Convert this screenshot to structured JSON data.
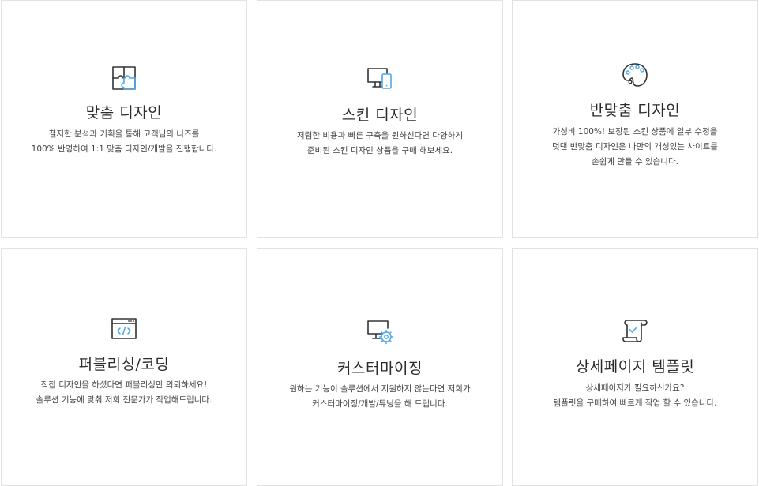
{
  "cards": [
    {
      "title": "맞춤 디자인",
      "lines": [
        "철저한 분석과 기획을 통해 고객님의 니즈를",
        "100% 반영하여 1:1 맞춤 디자인/개발을 진행합니다."
      ],
      "icon": "puzzle-icon"
    },
    {
      "title": "스킨 디자인",
      "lines": [
        "저렴한 비용과 빠른 구축을 원하신다면 다양하게",
        "준비된 스킨 디자인 상품을 구매 해보세요."
      ],
      "icon": "devices-icon"
    },
    {
      "title": "반맞춤 디자인",
      "lines": [
        "가성비 100%! 보장된 스킨 상품에 일부 수정을",
        "덧댄 반맞춤 디자인은 나만의 개성있는 사이트를",
        "손쉽게 만들 수 있습니다."
      ],
      "icon": "palette-icon"
    },
    {
      "title": "퍼블리싱/코딩",
      "lines": [
        "직접 디자인을 하셨다면 퍼블리싱만 의뢰하세요!",
        "솔루션 기능에 맞춰 저희 전문가가 작업해드립니다."
      ],
      "icon": "code-window-icon"
    },
    {
      "title": "커스터마이징",
      "lines": [
        "원하는 기능이 솔루션에서 지원하지 않는다면 저희가",
        "커스터마이징/개발/튜닝을 해 드립니다."
      ],
      "icon": "monitor-gear-icon"
    },
    {
      "title": "상세페이지 템플릿",
      "lines": [
        "상세페이지가 필요하신가요?",
        "템플릿을 구매하여 빠르게 작업 할 수 있습니다."
      ],
      "icon": "scroll-check-icon"
    }
  ],
  "colors": {
    "accent": "#4aa8f0",
    "icon_stroke": "#333333",
    "border": "#e2e2e2"
  }
}
